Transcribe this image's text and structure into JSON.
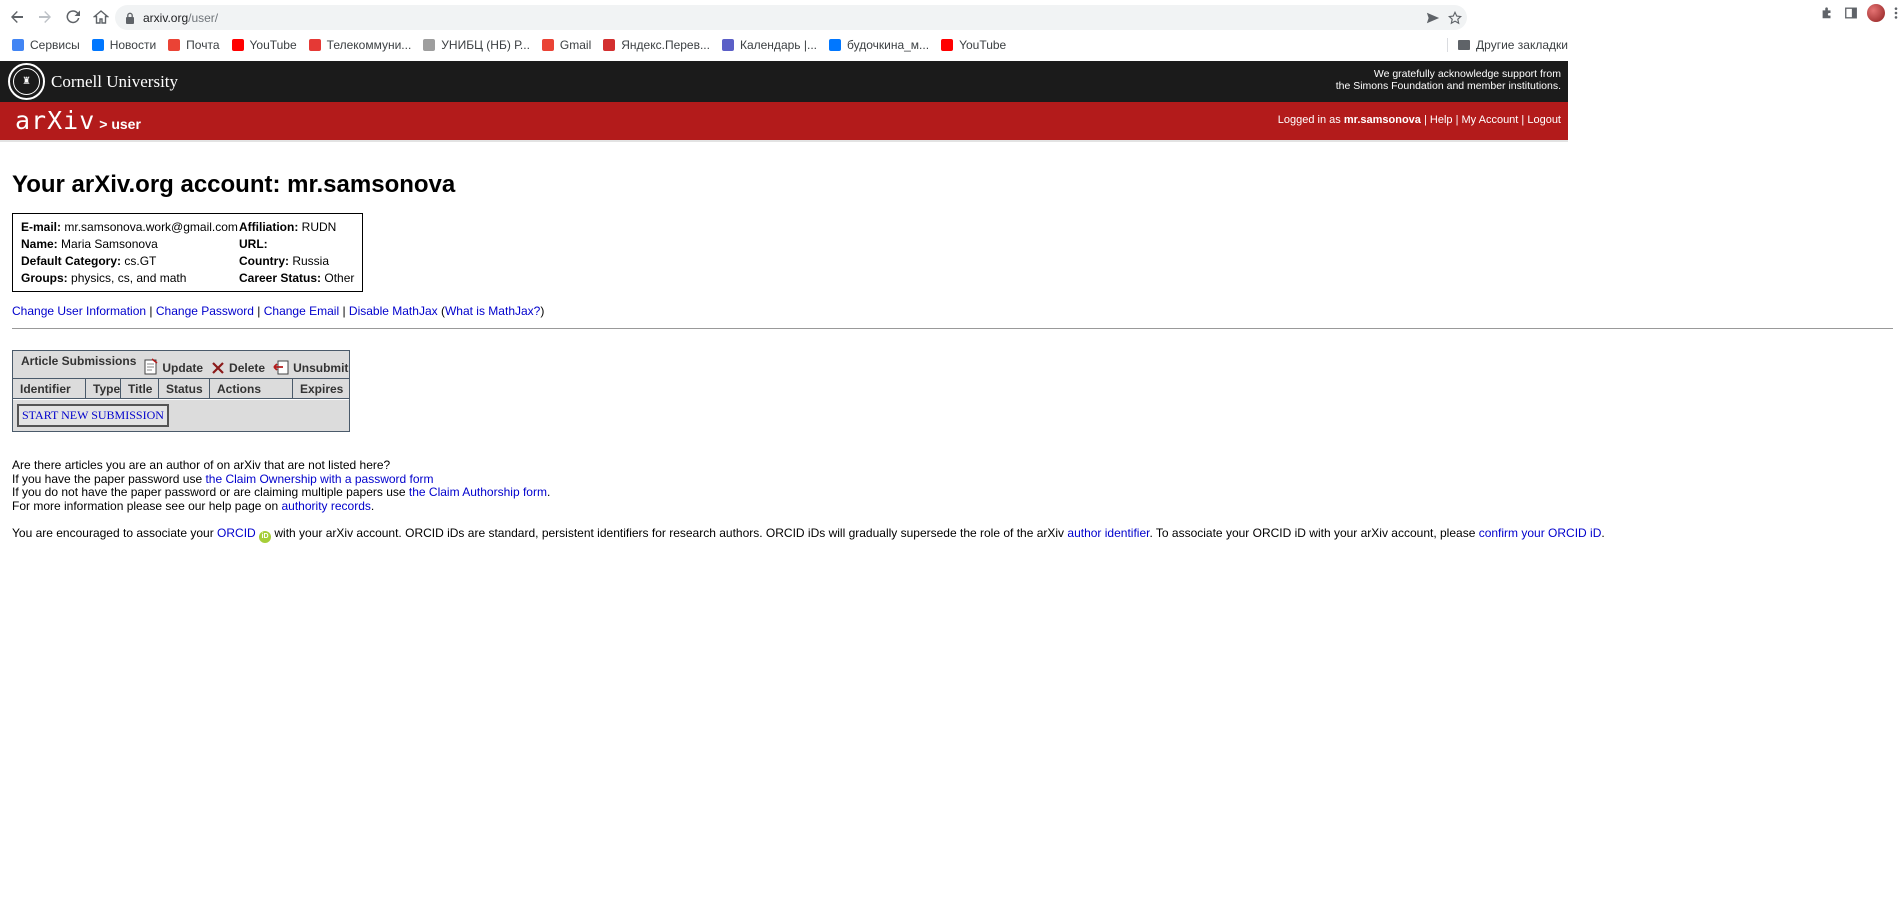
{
  "browser": {
    "url_host": "arxiv.org",
    "url_path": "/user/",
    "bookmarks": [
      {
        "label": "Сервисы",
        "icon": "apps-grid-icon",
        "color": "#4285f4"
      },
      {
        "label": "Новости",
        "icon": "vk-icon",
        "color": "#0077ff"
      },
      {
        "label": "Почта",
        "icon": "gmail-icon",
        "color": "#ea4335"
      },
      {
        "label": "YouTube",
        "icon": "youtube-icon",
        "color": "#ff0000"
      },
      {
        "label": "Телекоммуни...",
        "icon": "telecom-icon",
        "color": "#e53935"
      },
      {
        "label": "УНИБЦ (НБ) Р...",
        "icon": "globe-icon",
        "color": "#9e9e9e"
      },
      {
        "label": "Gmail",
        "icon": "gmail-icon",
        "color": "#ea4335"
      },
      {
        "label": "Яндекс.Перев...",
        "icon": "yandex-translate-icon",
        "color": "#d32f2f"
      },
      {
        "label": "Календарь |...",
        "icon": "teams-icon",
        "color": "#5b5fc7"
      },
      {
        "label": "будочкина_м...",
        "icon": "vk-icon",
        "color": "#0077ff"
      },
      {
        "label": "YouTube",
        "icon": "youtube-icon",
        "color": "#ff0000"
      }
    ],
    "other_bookmarks": "Другие закладки"
  },
  "cornell": {
    "name": "Cornell University",
    "ack_line1": "We gratefully acknowledge support from",
    "ack_line2": "the Simons Foundation and member institutions."
  },
  "arxiv": {
    "logo": "arXiv",
    "crumb": "> user",
    "logged_in_prefix": "Logged in as",
    "username": "mr.samsonova",
    "help": "Help",
    "my_account": "My Account",
    "logout": "Logout"
  },
  "page": {
    "title": "Your arXiv.org account: mr.samsonova",
    "info": {
      "email_label": "E-mail:",
      "email": "mr.samsonova.work@gmail.com",
      "affiliation_label": "Affiliation:",
      "affiliation": "RUDN",
      "name_label": "Name:",
      "name": "Maria Samsonova",
      "url_label": "URL:",
      "url": "",
      "category_label": "Default Category:",
      "category": "cs.GT",
      "country_label": "Country:",
      "country": "Russia",
      "groups_label": "Groups:",
      "groups": "physics, cs, and math",
      "career_label": "Career Status:",
      "career": "Other"
    },
    "links": {
      "change_info": "Change User Information",
      "change_password": "Change Password",
      "change_email": "Change Email",
      "disable_mathjax": "Disable MathJax",
      "what_mathjax": "What is MathJax?"
    },
    "submissions": {
      "title": "Article Submissions",
      "update": "Update",
      "delete": "Delete",
      "unsubmit": "Unsubmit",
      "columns": [
        "Identifier",
        "Type",
        "Title",
        "Status",
        "Actions",
        "Expires"
      ],
      "start_button": "START NEW SUBMISSION"
    },
    "claim": {
      "line1": "Are there articles you are an author of on arXiv that are not listed here?",
      "line2_pre": "If you have the paper password use ",
      "line2_link": "the Claim Ownership with a password form",
      "line3_pre": "If you do not have the paper password or are claiming multiple papers use ",
      "line3_link": "the Claim Authorship form",
      "line3_post": ".",
      "line4_pre": "For more information please see our help page on ",
      "line4_link": "authority records",
      "line4_post": "."
    },
    "orcid": {
      "pre": "You are encouraged to associate your ",
      "orcid_link": "ORCID",
      "mid": " with your arXiv account. ORCID iDs are standard, persistent identifiers for research authors. ORCID iDs will gradually supersede the role of the arXiv ",
      "author_link": "author identifier",
      "mid2": ". To associate your ORCID iD with your arXiv account, please ",
      "confirm_link": "confirm your ORCID iD",
      "post": "."
    }
  }
}
